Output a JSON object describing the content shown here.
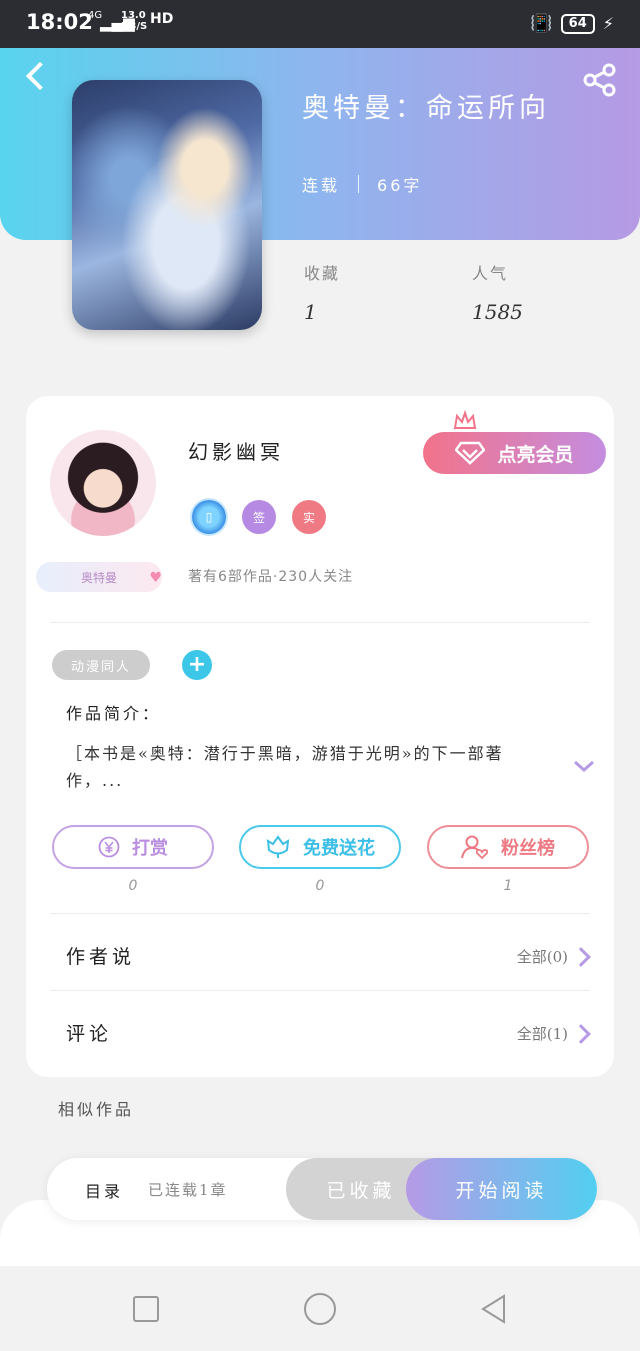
{
  "status_bar": {
    "time": "18:02",
    "network_type": "4G",
    "speed_value": "13.0",
    "speed_unit": "KB/S",
    "hd_label": "HD",
    "battery": "64"
  },
  "header": {
    "title": "奥特曼：命运所向",
    "status": "连载",
    "word_count": "66字"
  },
  "stats": {
    "favorites_label": "收藏",
    "favorites_value": "1",
    "popularity_label": "人气",
    "popularity_value": "1585"
  },
  "author": {
    "name": "幻影幽冥",
    "tag": "奥特曼",
    "summary": "著有6部作品·230人关注",
    "badges": [
      "phone-verified-icon",
      "签",
      "实"
    ],
    "vip_button": "点亮会员"
  },
  "book": {
    "genre_tag": "动漫同人",
    "add_tag": "+",
    "intro_label": "作品简介：",
    "intro_text": "［本书是«奥特：潜行于黑暗，游猎于光明»的下一部著作，..."
  },
  "actions": [
    {
      "label": "打赏",
      "count": "0",
      "icon": "yuan-coin-icon"
    },
    {
      "label": "免费送花",
      "count": "0",
      "icon": "flower-icon"
    },
    {
      "label": "粉丝榜",
      "count": "1",
      "icon": "fan-user-icon"
    }
  ],
  "sections": {
    "author_says_label": "作者说",
    "author_says_link": "全部(0)",
    "comments_label": "评论",
    "comments_link": "全部(1)",
    "similar_label": "相似作品"
  },
  "bottom_bar": {
    "toc_label": "目录",
    "chapter_status": "已连载1章",
    "collected_label": "已收藏",
    "read_label": "开始阅读"
  },
  "colors": {
    "accent_blue": "#3cc7e9",
    "accent_purple": "#b69ae6",
    "accent_pink": "#f2738a"
  }
}
